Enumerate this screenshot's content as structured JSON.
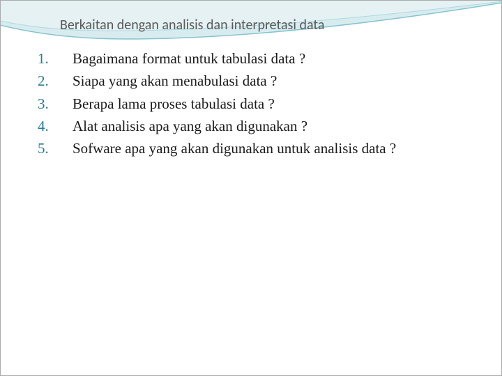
{
  "title": "Berkaitan dengan analisis dan interpretasi data",
  "items": [
    {
      "num": "1.",
      "text": "Bagaimana format untuk tabulasi data ?"
    },
    {
      "num": "2.",
      "text": "Siapa yang akan menabulasi data ?"
    },
    {
      "num": "3.",
      "text": "Berapa lama proses tabulasi data ?"
    },
    {
      "num": "4.",
      "text": "Alat analisis apa yang akan digunakan ?"
    },
    {
      "num": "5.",
      "text": "Sofware apa yang akan digunakan untuk analisis data ?"
    }
  ]
}
